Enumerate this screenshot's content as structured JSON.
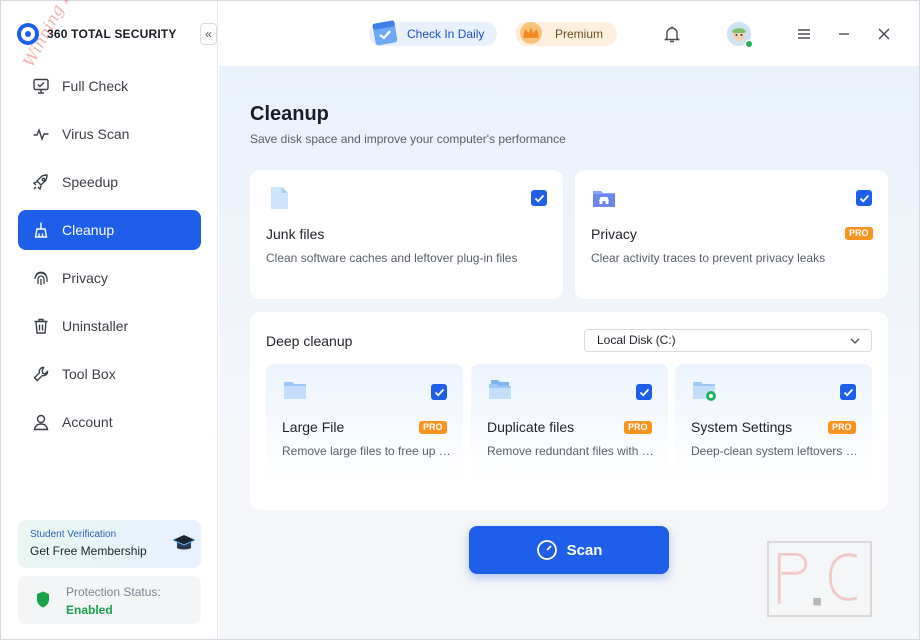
{
  "app": {
    "name": "360 TOTAL SECURITY",
    "collapse_glyph": "«"
  },
  "sidebar": {
    "items": [
      {
        "label": "Full Check",
        "icon": "monitor-icon"
      },
      {
        "label": "Virus Scan",
        "icon": "pulse-icon"
      },
      {
        "label": "Speedup",
        "icon": "rocket-icon"
      },
      {
        "label": "Cleanup",
        "icon": "broom-icon",
        "active": true
      },
      {
        "label": "Privacy",
        "icon": "fingerprint-icon"
      },
      {
        "label": "Uninstaller",
        "icon": "trash-icon"
      },
      {
        "label": "Tool Box",
        "icon": "wrench-icon"
      },
      {
        "label": "Account",
        "icon": "user-icon"
      }
    ],
    "student": {
      "title": "Student Verification",
      "subtitle": "Get Free Membership"
    },
    "protection": {
      "title": "Protection Status:",
      "status": "Enabled"
    }
  },
  "topbar": {
    "checkin_label": "Check In Daily",
    "premium_label": "Premium"
  },
  "main": {
    "title": "Cleanup",
    "subtitle": "Save disk space and improve your computer's performance",
    "junk": {
      "title": "Junk files",
      "desc": "Clean software caches and leftover plug-in files",
      "checked": true
    },
    "privacy": {
      "title": "Privacy",
      "desc": "Clear activity traces to prevent privacy leaks",
      "badge": "PRO",
      "checked": true
    },
    "deep": {
      "title": "Deep cleanup",
      "disk": "Local Disk (C:)",
      "items": [
        {
          "title": "Large File",
          "desc": "Remove large files to free up space",
          "badge": "PRO",
          "checked": true
        },
        {
          "title": "Duplicate files",
          "desc": "Remove redundant files with the same content",
          "badge": "PRO",
          "checked": true
        },
        {
          "title": "System Settings",
          "desc": "Deep-clean system leftovers and caches",
          "badge": "PRO",
          "checked": true
        }
      ]
    },
    "scan_label": "Scan"
  },
  "watermark": {
    "text": "Winning PC"
  },
  "colors": {
    "accent": "#1f5ee8",
    "pro": "#f7931e",
    "enabled": "#18a34a"
  }
}
